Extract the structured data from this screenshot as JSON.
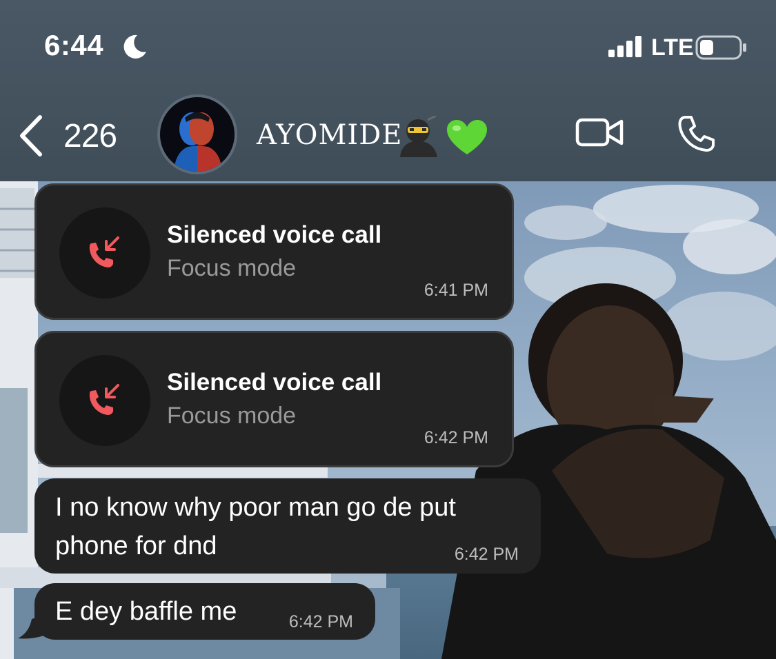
{
  "status_bar": {
    "time": "6:44",
    "focus_icon": "moon-icon",
    "signal_icon": "cellular-signal-icon",
    "network": "LTE",
    "battery_icon": "battery-icon",
    "battery_level": 0.35
  },
  "header": {
    "back_icon": "chevron-left-icon",
    "back_count": "226",
    "contact_name": "AYOMIDE",
    "name_emojis": [
      "ninja-emoji",
      "green-heart-emoji"
    ],
    "video_icon": "video-camera-icon",
    "call_icon": "phone-icon"
  },
  "messages": [
    {
      "type": "call",
      "icon": "missed-call-icon",
      "title": "Silenced voice call",
      "subtitle": "Focus mode",
      "time": "6:41 PM"
    },
    {
      "type": "call",
      "icon": "missed-call-icon",
      "title": "Silenced voice call",
      "subtitle": "Focus mode",
      "time": "6:42 PM"
    },
    {
      "type": "text",
      "text": "I no know why poor man go de put phone for dnd",
      "time": "6:42 PM"
    },
    {
      "type": "text",
      "text": "E dey baffle me",
      "time": "6:42 PM"
    }
  ],
  "colors": {
    "header_bg": "#44525e",
    "bubble_bg": "#232323",
    "missed_call": "#f05a5e",
    "timestamp": "#bdbdbd",
    "subtitle": "#9a9a9a"
  }
}
